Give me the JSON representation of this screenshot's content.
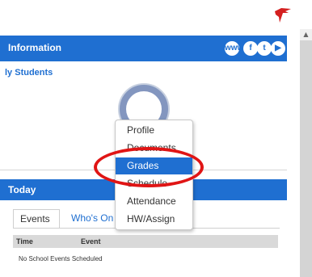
{
  "header": {
    "logo_icon": "red-hawk-logo"
  },
  "info_panel": {
    "title": "Information",
    "social_icons": [
      "web-icon",
      "facebook-icon",
      "twitter-icon",
      "youtube-icon"
    ],
    "social_glyphs": [
      "www",
      "f",
      "t",
      "▶"
    ]
  },
  "students": {
    "heading": "ly Students"
  },
  "student_menu": {
    "items": [
      {
        "label": "Profile"
      },
      {
        "label": "Documents"
      },
      {
        "label": "Grades"
      },
      {
        "label": "Schedule"
      },
      {
        "label": "Attendance"
      },
      {
        "label": "HW/Assign"
      }
    ],
    "selected": "Grades"
  },
  "today_panel": {
    "title": "Today",
    "tabs": [
      {
        "label": "Events"
      },
      {
        "label": "Who's On"
      }
    ],
    "columns": [
      "Time",
      "Event"
    ],
    "empty_message": "No School Events Scheduled"
  },
  "colors": {
    "accent": "#1f6fd1",
    "annotation": "#e01515",
    "logo": "#d42020"
  }
}
